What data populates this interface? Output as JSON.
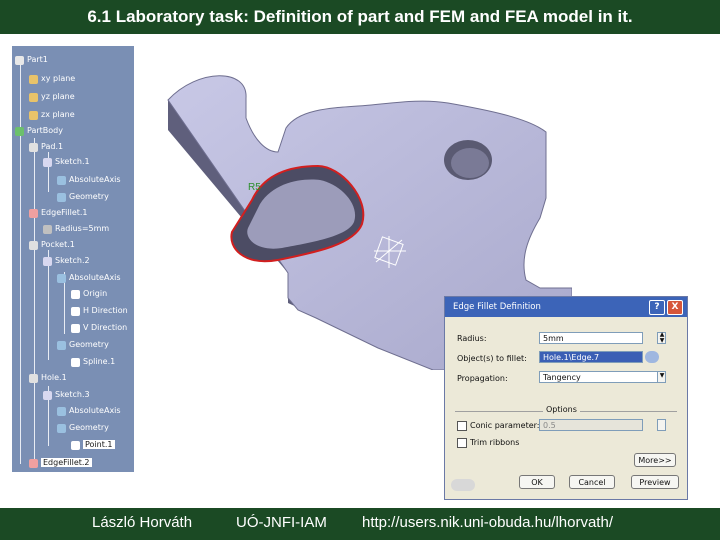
{
  "header": {
    "title": "6.1 Laboratory task: Definition of part and FEM and FEA model in it."
  },
  "footer": {
    "author": "László Horváth",
    "institute": "UÓ-JNFI-IAM",
    "url": "http://users.nik.uni-obuda.hu/lhorvath/"
  },
  "tree": {
    "nodes": [
      {
        "label": "Part1",
        "icon": "part-icon"
      },
      {
        "label": "xy plane",
        "icon": "plane-icon"
      },
      {
        "label": "yz plane",
        "icon": "plane-icon"
      },
      {
        "label": "zx plane",
        "icon": "plane-icon"
      },
      {
        "label": "PartBody",
        "icon": "body-icon"
      },
      {
        "label": "Pad.1",
        "icon": "pad-icon"
      },
      {
        "label": "Sketch.1",
        "icon": "sketch-icon"
      },
      {
        "label": "AbsoluteAxis",
        "icon": "axis-icon"
      },
      {
        "label": "Geometry",
        "icon": "geometry-icon"
      },
      {
        "label": "EdgeFillet.1",
        "icon": "fillet-icon"
      },
      {
        "label": "Radius=5mm",
        "icon": "parameter-icon"
      },
      {
        "label": "Pocket.1",
        "icon": "pocket-icon"
      },
      {
        "label": "Sketch.2",
        "icon": "sketch-icon"
      },
      {
        "label": "AbsoluteAxis",
        "icon": "axis-icon"
      },
      {
        "label": "Origin",
        "icon": "point-icon"
      },
      {
        "label": "H Direction",
        "icon": "line-icon"
      },
      {
        "label": "V Direction",
        "icon": "line-icon"
      },
      {
        "label": "Geometry",
        "icon": "geometry-icon"
      },
      {
        "label": "Spline.1",
        "icon": "spline-icon"
      },
      {
        "label": "Hole.1",
        "icon": "hole-icon"
      },
      {
        "label": "Sketch.3",
        "icon": "sketch-icon"
      },
      {
        "label": "AbsoluteAxis",
        "icon": "axis-icon"
      },
      {
        "label": "Geometry",
        "icon": "geometry-icon"
      },
      {
        "label": "Point.1",
        "icon": "point-icon"
      },
      {
        "label": "EdgeFillet.2",
        "icon": "fillet-icon"
      }
    ]
  },
  "viewport": {
    "edge_label": "R5"
  },
  "dialog": {
    "title": "Edge Fillet Definition",
    "help_button": "?",
    "close_button": "X",
    "radius_label": "Radius:",
    "radius_value": "5mm",
    "objects_label": "Object(s) to fillet:",
    "objects_value": "Hole.1\\Edge.7",
    "propagation_label": "Propagation:",
    "propagation_value": "Tangency",
    "options_label": "Options",
    "conic_label": "Conic parameter:",
    "conic_value": "0.5",
    "trim_label": "Trim ribbons",
    "more_button": "More>>",
    "ok_button": "OK",
    "cancel_button": "Cancel",
    "preview_button": "Preview"
  },
  "colors": {
    "header_bg": "#1b4a24",
    "tree_bg": "#7a8fb4",
    "part_face": "#b9b9d9",
    "part_side": "#6a6a86",
    "selected_edge": "#d21f1f",
    "dialog_title": "#3c64b8"
  }
}
